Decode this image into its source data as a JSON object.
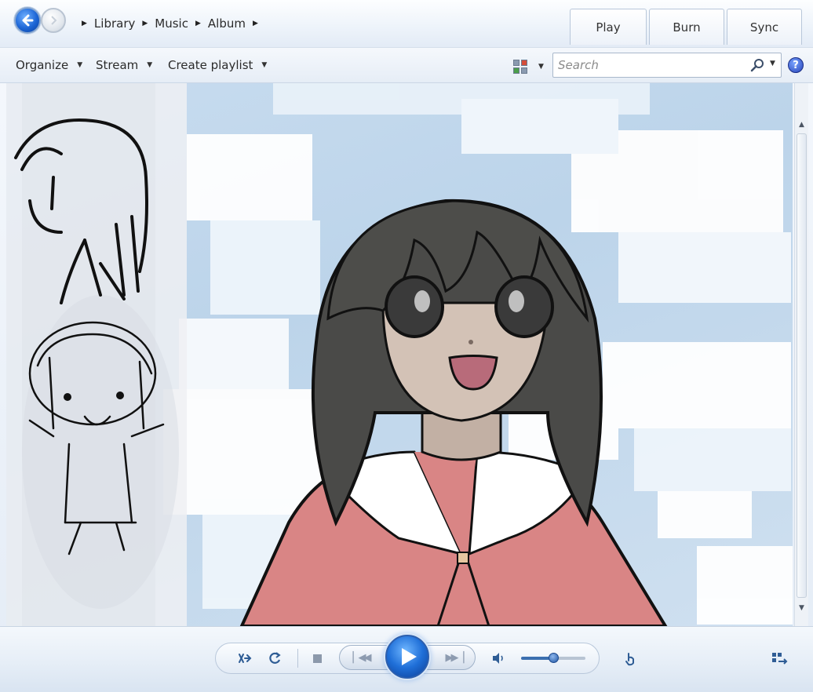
{
  "navbar": {
    "breadcrumb": [
      "Library",
      "Music",
      "Album"
    ],
    "tabs": [
      "Play",
      "Burn",
      "Sync"
    ]
  },
  "toolbar": {
    "organize": "Organize",
    "stream": "Stream",
    "create_playlist": "Create playlist",
    "search_placeholder": "Search",
    "help": "?"
  },
  "visualization": {
    "content": "anime-character-artwork",
    "sky_color": "#c8dcef",
    "hair_color": "#4a4a48",
    "uniform_color": "#d98585"
  },
  "transport": {
    "volume_level": 0.5,
    "accent_color": "#1f6fd8"
  },
  "icons": [
    "back-icon",
    "forward-icon",
    "view-options-icon",
    "search-icon",
    "help-icon",
    "shuffle-icon",
    "repeat-icon",
    "stop-icon",
    "previous-icon",
    "play-icon",
    "next-icon",
    "volume-icon",
    "touch-icon",
    "switch-view-icon"
  ]
}
